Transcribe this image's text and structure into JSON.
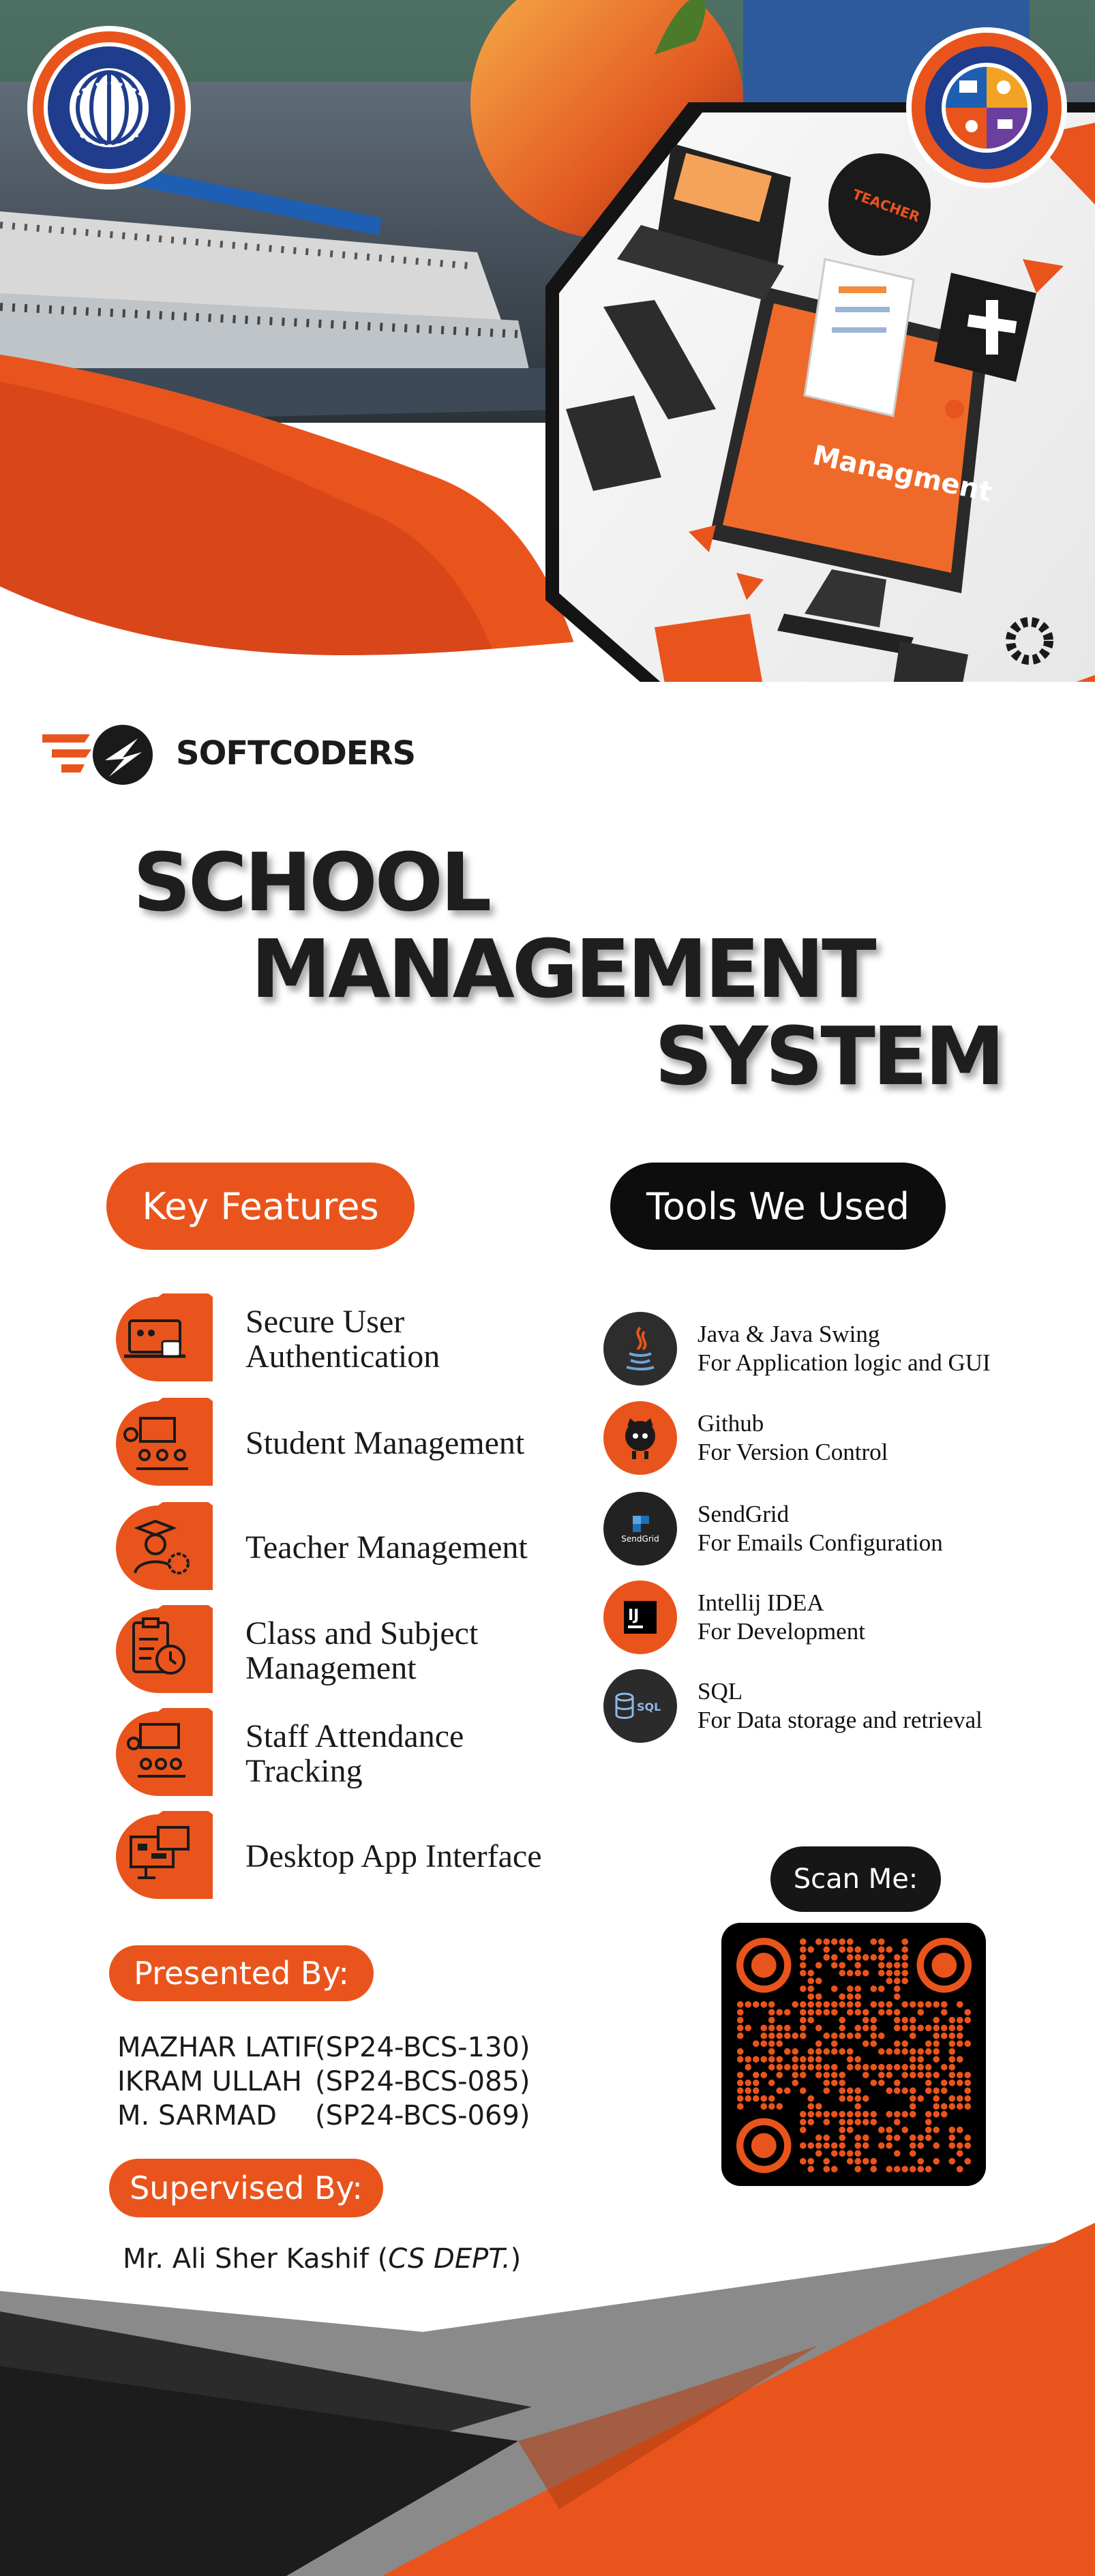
{
  "brand": {
    "name": "SOFTCODERS"
  },
  "logos": {
    "university": "COMSATS UNIVERSITY ISLAMABAD",
    "department": "COMPUTER SCIENCE DEPARTMENT CUI,SAHIWAL"
  },
  "hero": {
    "screen_text": "Managment",
    "gear_text": "TEACHER"
  },
  "title": {
    "line1": "SCHOOL",
    "line2": "MANAGEMENT",
    "line3": "SYSTEM"
  },
  "key_features": {
    "heading": "Key Features",
    "items": [
      {
        "label": "Secure User\nAuthentication",
        "icon": "laptop-lock-icon"
      },
      {
        "label": "Student Management",
        "icon": "classroom-students-icon"
      },
      {
        "label": "Teacher Management",
        "icon": "teacher-gear-icon"
      },
      {
        "label": "Class and Subject\nManagement",
        "icon": "clipboard-clock-icon"
      },
      {
        "label": "Staff Attendance\nTracking",
        "icon": "presentation-staff-icon"
      },
      {
        "label": "Desktop App Interface",
        "icon": "desktop-app-icon"
      }
    ]
  },
  "tools": {
    "heading": "Tools We Used",
    "items": [
      {
        "name": "Java & Java Swing",
        "desc": "For Application logic and GUI",
        "icon": "java-icon"
      },
      {
        "name": "Github",
        "desc": "For Version Control",
        "icon": "github-icon"
      },
      {
        "name": "SendGrid",
        "desc": "For Emails Configuration",
        "icon": "sendgrid-icon",
        "badge": "SendGrid"
      },
      {
        "name": "Intellij IDEA",
        "desc": "For Development",
        "icon": "intellij-icon",
        "badge": "IJ"
      },
      {
        "name": "SQL",
        "desc": "For Data storage and retrieval",
        "icon": "sql-database-icon",
        "badge": "SQL"
      }
    ]
  },
  "presented": {
    "heading": "Presented By:",
    "people": [
      {
        "name": "MAZHAR LATIF",
        "reg": "(SP24-BCS-130)"
      },
      {
        "name": "IKRAM ULLAH",
        "reg": "(SP24-BCS-085)"
      },
      {
        "name": "M. SARMAD",
        "reg": "(SP24-BCS-069)"
      }
    ]
  },
  "supervised": {
    "heading": "Supervised By:",
    "name": "Mr. Ali Sher Kashif (",
    "dept": "CS DEPT.",
    "close": ")"
  },
  "scan": {
    "label": "Scan Me:"
  },
  "colors": {
    "accent": "#e9541c",
    "dark": "#111111",
    "background": "#ffffff"
  }
}
